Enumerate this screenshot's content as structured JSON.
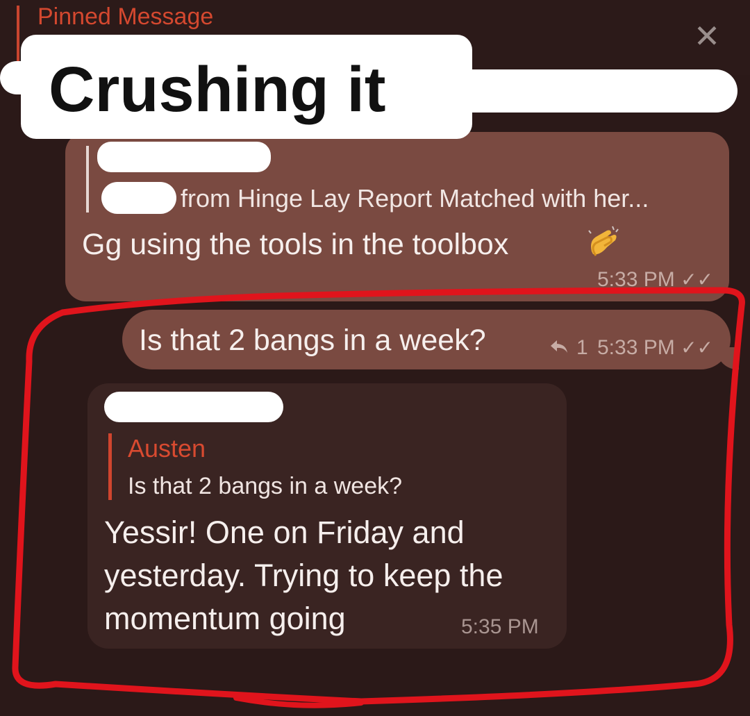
{
  "pinned": {
    "label": "Pinned Message",
    "close_icon": "close-icon"
  },
  "overlay": {
    "caption": "Crushing it"
  },
  "messages": [
    {
      "direction": "outgoing",
      "quote_text": "from Hinge Lay Report  Matched with her...",
      "text": "Gg using the tools in the toolbox",
      "emoji": "clapping-hands-emoji",
      "time": "5:33 PM"
    },
    {
      "direction": "outgoing",
      "text": "Is that 2 bangs in a week?",
      "reply_count": "1",
      "time": "5:33 PM"
    },
    {
      "direction": "incoming",
      "quote_name": "Austen",
      "quote_text": "Is that 2 bangs in a week?",
      "text": "Yessir! One on Friday and yesterday. Trying to keep the momentum going",
      "time": "5:35 PM"
    }
  ],
  "colors": {
    "background": "#2b1918",
    "outgoing_bubble": "#7a4a41",
    "incoming_bubble": "#3a2422",
    "accent": "#d4482f",
    "annotation": "#e0141c"
  }
}
